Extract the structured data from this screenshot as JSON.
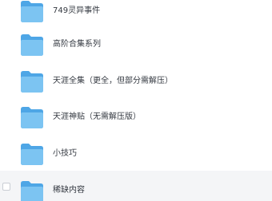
{
  "file_list": {
    "items": [
      {
        "name": "749灵异事件",
        "type": "folder",
        "icon": "folder-icon"
      },
      {
        "name": "高阶合集系列",
        "type": "folder",
        "icon": "folder-icon"
      },
      {
        "name": "天涯全集（更全，但部分需解压）",
        "type": "folder",
        "icon": "folder-icon"
      },
      {
        "name": "天涯神贴（无需解压版）",
        "type": "folder",
        "icon": "folder-icon"
      },
      {
        "name": "小技巧",
        "type": "folder",
        "icon": "folder-icon"
      },
      {
        "name": "稀缺内容",
        "type": "folder",
        "icon": "folder-icon",
        "hovered": true
      }
    ]
  },
  "colors": {
    "folder_front": "#7cc4f2",
    "folder_back": "#4ea6e6",
    "hover_bg": "#f4f5f7",
    "text": "#333840"
  }
}
